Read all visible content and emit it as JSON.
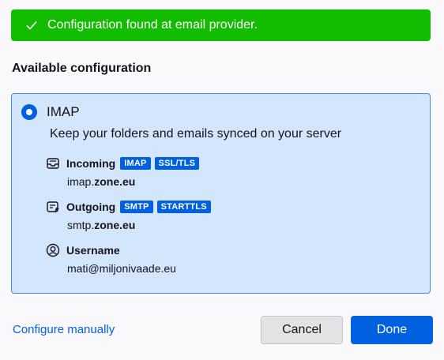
{
  "banner": {
    "message": "Configuration found at email provider.",
    "icon": "checkmark-icon",
    "color": "#12bc00"
  },
  "section_title": "Available configuration",
  "config": {
    "protocol": "IMAP",
    "selected": true,
    "description": "Keep your folders and emails synced on your server",
    "incoming": {
      "label": "Incoming",
      "icon": "inbox-icon",
      "badges": [
        "IMAP",
        "SSL/TLS"
      ],
      "host_prefix": "imap.",
      "host_domain": "zone.eu"
    },
    "outgoing": {
      "label": "Outgoing",
      "icon": "outbox-icon",
      "badges": [
        "SMTP",
        "STARTTLS"
      ],
      "host_prefix": "smtp.",
      "host_domain": "zone.eu"
    },
    "username": {
      "label": "Username",
      "icon": "user-icon",
      "value": "mati@miljonivaade.eu"
    }
  },
  "footer": {
    "configure_manually": "Configure manually",
    "cancel": "Cancel",
    "done": "Done"
  },
  "colors": {
    "accent": "#0061e0",
    "card_bg": "#d4e6fb",
    "card_border": "#3f8de0"
  }
}
